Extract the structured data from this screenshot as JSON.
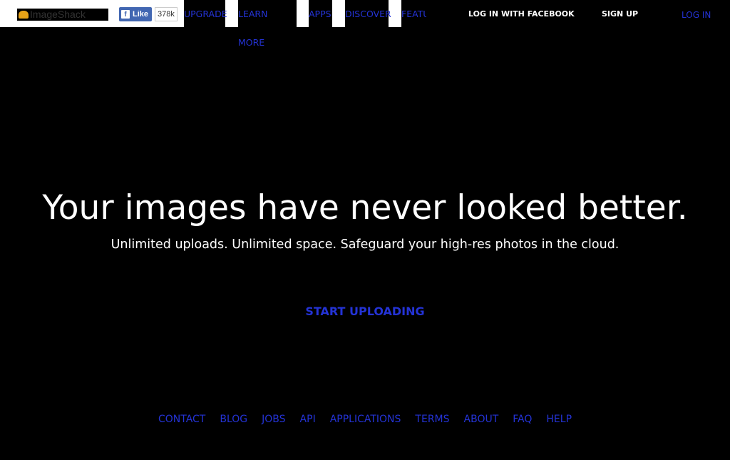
{
  "header": {
    "logo": "ImageShack",
    "fb_like": "Like",
    "fb_count": "378k",
    "nav": [
      "UPGRADE",
      "LEARN MORE",
      "APPS",
      "DISCOVER",
      "FEATU"
    ],
    "login_facebook": "LOG IN WITH FACEBOOK",
    "signup": "SIGN UP",
    "login": "LOG IN"
  },
  "hero": {
    "title": "Your images have never looked better.",
    "subtitle": "Unlimited uploads. Unlimited space. Safeguard your high-res photos in the cloud.",
    "cta": "START UPLOADING"
  },
  "footer": [
    "CONTACT",
    "BLOG",
    "JOBS",
    "API",
    "APPLICATIONS",
    "TERMS",
    "ABOUT",
    "FAQ",
    "HELP"
  ]
}
